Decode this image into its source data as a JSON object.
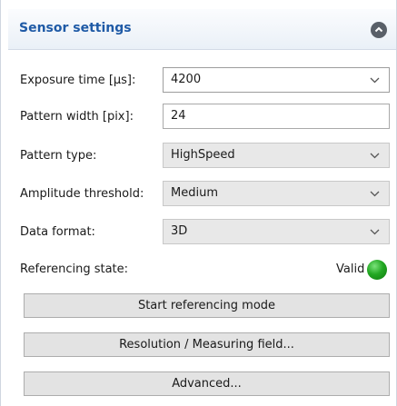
{
  "panel": {
    "title": "Sensor settings",
    "collapse_icon": "chevron-up-circle-icon"
  },
  "fields": {
    "exposure_time": {
      "label": "Exposure time [µs]:",
      "value": "4200"
    },
    "pattern_width": {
      "label": "Pattern width [pix]:",
      "value": "24"
    },
    "pattern_type": {
      "label": "Pattern type:",
      "value": "HighSpeed"
    },
    "amplitude_threshold": {
      "label": "Amplitude threshold:",
      "value": "Medium"
    },
    "data_format": {
      "label": "Data format:",
      "value": "3D"
    }
  },
  "referencing": {
    "label": "Referencing state:",
    "value": "Valid",
    "status_color": "#1faa1f"
  },
  "buttons": {
    "start_referencing": "Start referencing mode",
    "resolution": "Resolution / Measuring field...",
    "advanced": "Advanced..."
  },
  "colors": {
    "title": "#1f5aa6",
    "button_bg": "#e3e3e3",
    "header_bg": "#eef3f9"
  }
}
